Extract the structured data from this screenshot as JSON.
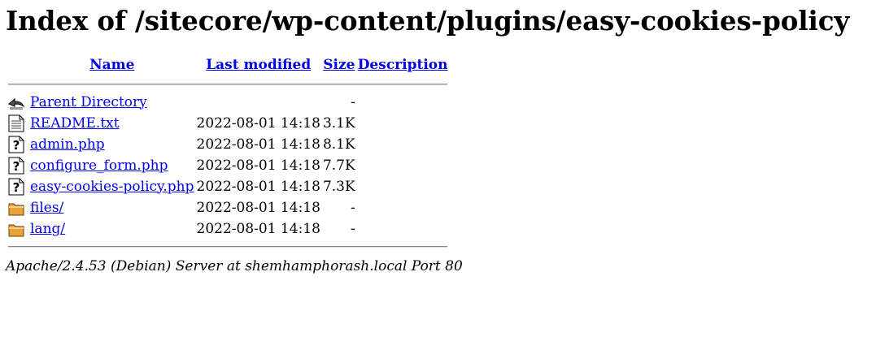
{
  "page_title": "Index of /sitecore/wp-content/plugins/easy-cookies-policy",
  "columns": {
    "name": "Name",
    "last_modified": "Last modified",
    "size": "Size",
    "description": "Description"
  },
  "rows": [
    {
      "icon": "back-icon",
      "name": "Parent Directory",
      "modified": "",
      "size": "-"
    },
    {
      "icon": "text-file-icon",
      "name": "README.txt",
      "modified": "2022-08-01 14:18",
      "size": "3.1K"
    },
    {
      "icon": "unknown-file-icon",
      "name": "admin.php",
      "modified": "2022-08-01 14:18",
      "size": "8.1K"
    },
    {
      "icon": "unknown-file-icon",
      "name": "configure_form.php",
      "modified": "2022-08-01 14:18",
      "size": "7.7K"
    },
    {
      "icon": "unknown-file-icon",
      "name": "easy-cookies-policy.php",
      "modified": "2022-08-01 14:18",
      "size": "7.3K"
    },
    {
      "icon": "folder-icon",
      "name": "files/",
      "modified": "2022-08-01 14:18",
      "size": "-"
    },
    {
      "icon": "folder-icon",
      "name": "lang/",
      "modified": "2022-08-01 14:18",
      "size": "-"
    }
  ],
  "footer": "Apache/2.4.53 (Debian) Server at shemhamphorash.local Port 80",
  "colors": {
    "link": "#0000ee",
    "rule": "#888888"
  }
}
